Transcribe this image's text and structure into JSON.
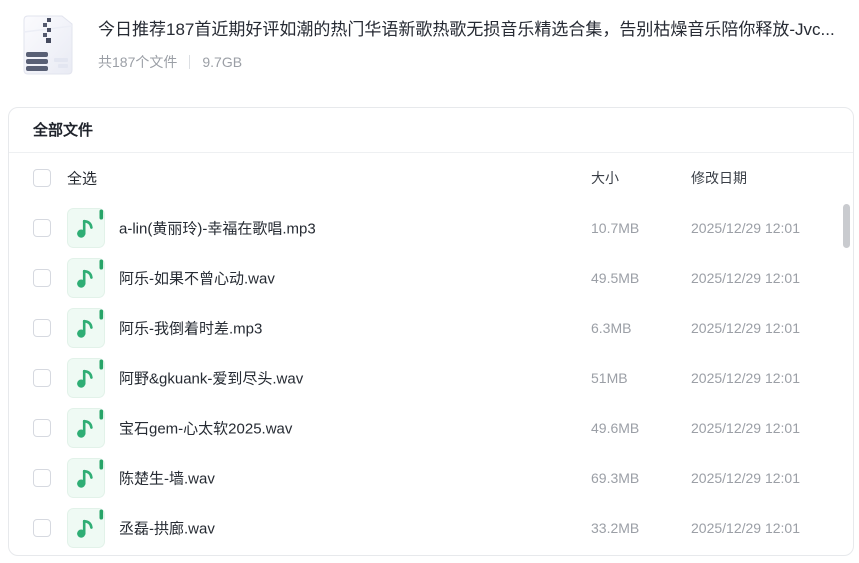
{
  "header": {
    "archive_icon": "zip-archive-icon",
    "title": "今日推荐187首近期好评如潮的热门华语新歌热歌无损音乐精选合集，告别枯燥音乐陪你释放-Jvc...",
    "file_count": "共187个文件",
    "total_size": "9.7GB"
  },
  "panel": {
    "title": "全部文件",
    "select_all_label": "全选",
    "columns": {
      "size": "大小",
      "date": "修改日期"
    },
    "files": [
      {
        "icon": "music-file-icon",
        "name": "a-lin(黄丽玲)-幸福在歌唱.mp3",
        "size": "10.7MB",
        "date": "2025/12/29 12:01"
      },
      {
        "icon": "music-file-icon",
        "name": "阿乐-如果不曾心动.wav",
        "size": "49.5MB",
        "date": "2025/12/29 12:01"
      },
      {
        "icon": "music-file-icon",
        "name": "阿乐-我倒着时差.mp3",
        "size": "6.3MB",
        "date": "2025/12/29 12:01"
      },
      {
        "icon": "music-file-icon",
        "name": "阿野&gkuank-爱到尽头.wav",
        "size": "51MB",
        "date": "2025/12/29 12:01"
      },
      {
        "icon": "music-file-icon",
        "name": "宝石gem-心太软2025.wav",
        "size": "49.6MB",
        "date": "2025/12/29 12:01"
      },
      {
        "icon": "music-file-icon",
        "name": "陈楚生-墙.wav",
        "size": "69.3MB",
        "date": "2025/12/29 12:01"
      },
      {
        "icon": "music-file-icon",
        "name": "丞磊-拱廊.wav",
        "size": "33.2MB",
        "date": "2025/12/29 12:01"
      }
    ]
  },
  "colors": {
    "accent_green": "#2fae75",
    "music_icon_bg": "#effaf4",
    "music_icon_fold": "#27a468",
    "text_dark": "#262a33",
    "text_gray": "#9b9fa6",
    "card_border": "#e7e9ec"
  }
}
